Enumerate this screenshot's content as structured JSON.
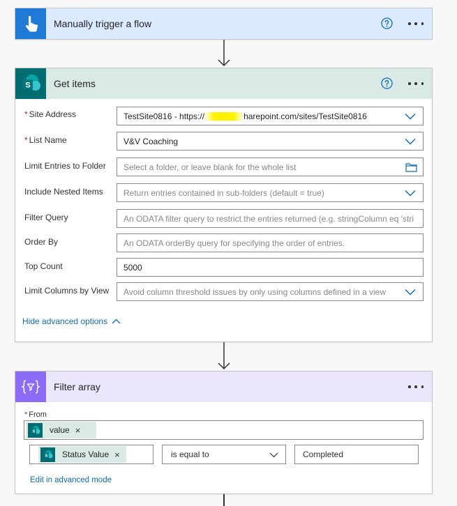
{
  "trigger": {
    "title": "Manually trigger a flow"
  },
  "get_items": {
    "title": "Get items",
    "fields": [
      {
        "label": "Site Address",
        "required": true,
        "value": "TestSite0816 - https://",
        "value_suffix": "harepoint.com/sites/TestSite0816",
        "kind": "dropdown"
      },
      {
        "label": "List Name",
        "required": true,
        "value": "V&V Coaching",
        "kind": "dropdown"
      },
      {
        "label": "Limit Entries to Folder",
        "required": false,
        "placeholder": "Select a folder, or leave blank for the whole list",
        "kind": "folder"
      },
      {
        "label": "Include Nested Items",
        "required": false,
        "placeholder": "Return entries contained in sub-folders (default = true)",
        "kind": "dropdown"
      },
      {
        "label": "Filter Query",
        "required": false,
        "placeholder": "An ODATA filter query to restrict the entries returned (e.g. stringColumn eq 'stri",
        "kind": "text"
      },
      {
        "label": "Order By",
        "required": false,
        "placeholder": "An ODATA orderBy query for specifying the order of entries.",
        "kind": "text"
      },
      {
        "label": "Top Count",
        "required": false,
        "value": "5000",
        "kind": "text"
      },
      {
        "label": "Limit Columns by View",
        "required": false,
        "placeholder": "Avoid column threshold issues by only using columns defined in a view",
        "kind": "dropdown"
      }
    ],
    "advanced_link": "Hide advanced options"
  },
  "filter_array": {
    "title": "Filter array",
    "from_label": "From",
    "from_token": "value",
    "condition_token": "Status Value",
    "operator": "is equal to",
    "compare_value": "Completed",
    "advanced_mode_link": "Edit in advanced mode"
  },
  "colors": {
    "trigger_header": "#dbeafe",
    "trigger_icon": "#1e7ad4",
    "getitems_header": "#d9e9e6",
    "sharepoint": "#036c70",
    "filter_header": "#ece6fb",
    "filter_icon": "#8c6cf7",
    "link": "#0f6cbd",
    "required": "#a4262c"
  },
  "required_mark": "*",
  "close_glyph": "×"
}
